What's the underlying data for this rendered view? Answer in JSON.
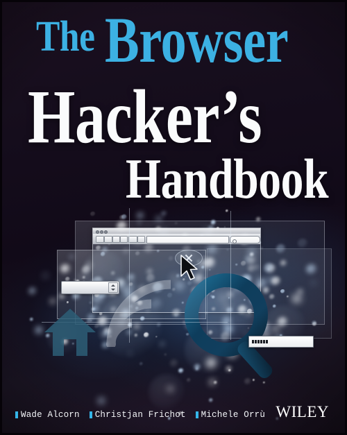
{
  "cover": {
    "title_lines": [
      {
        "id": "the",
        "text": "The",
        "color": "#3cb1e3"
      },
      {
        "id": "browser",
        "text": "Browser",
        "color": "#3cb1e3"
      },
      {
        "id": "hacker",
        "text": "Hacker’s",
        "color": "#fafbfc"
      },
      {
        "id": "handbook",
        "text": "Handbook",
        "color": "#fafbfc"
      }
    ],
    "authors": [
      {
        "name": "Wade Alcorn",
        "bullet_color": "#35b5e8"
      },
      {
        "name": "Christjan Frichot",
        "bullet_color": "#35b5e8"
      },
      {
        "name": "Michele Orrù",
        "bullet_color": "#35b5e8"
      }
    ],
    "publisher": "WILEY",
    "background_color": "#150d1c",
    "accent_color": "#3cb1e3"
  },
  "artwork": {
    "browser_window": {
      "traffic_lights": [
        "close-dot",
        "minimize-dot",
        "zoom-dot"
      ],
      "toolbar_buttons": [
        "back-button",
        "forward-button",
        "stop-button",
        "reload-button",
        "home-button",
        "bookmark-button"
      ],
      "url_bar_value": "",
      "search_bar_value": "",
      "search_icon": "magnifier-icon"
    },
    "password_field": {
      "masked_value": "••••••",
      "dot_count": 6
    },
    "spinner_field": {
      "value": "",
      "up_arrow": "chevron-up-icon",
      "down_arrow": "chevron-down-icon"
    },
    "icons": [
      "home-icon",
      "wifi-signal-icon",
      "magnifying-glass-icon",
      "close-x-icon",
      "mouse-cursor-icon"
    ]
  }
}
